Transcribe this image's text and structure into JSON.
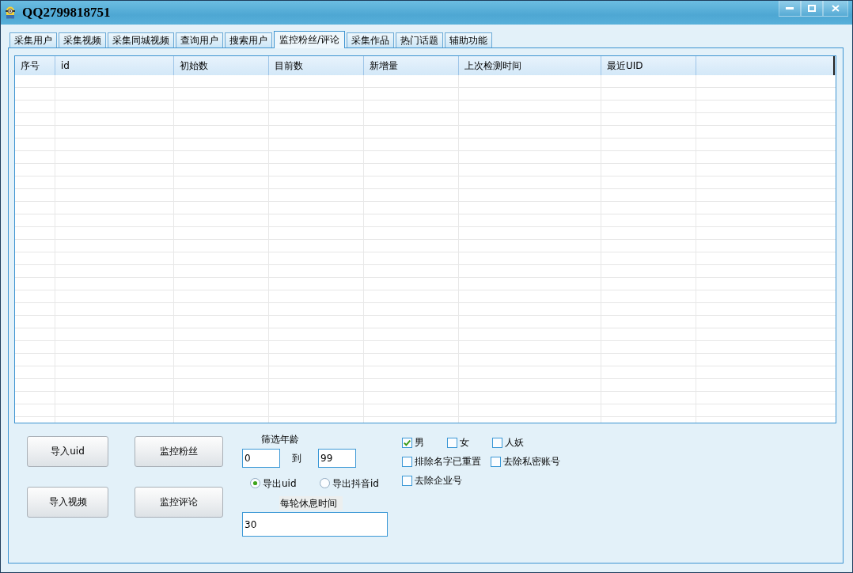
{
  "window": {
    "title": "QQ2799818751"
  },
  "tabs": [
    {
      "label": "采集用户",
      "selected": false
    },
    {
      "label": "采集视频",
      "selected": false
    },
    {
      "label": "采集同城视频",
      "selected": false
    },
    {
      "label": "查询用户",
      "selected": false
    },
    {
      "label": "搜索用户",
      "selected": false
    },
    {
      "label": "监控粉丝/评论",
      "selected": true
    },
    {
      "label": "采集作品",
      "selected": false
    },
    {
      "label": "热门话题",
      "selected": false
    },
    {
      "label": "辅助功能",
      "selected": false
    }
  ],
  "table": {
    "columns": [
      "序号",
      "id",
      "初始数",
      "目前数",
      "新增量",
      "上次检测时间",
      "最近UID"
    ]
  },
  "buttons": [
    "导入uid",
    "监控粉丝",
    "导入视频",
    "监控评论"
  ],
  "age_filter": {
    "label": "筛选年龄",
    "from": "0",
    "separator": "到",
    "to": "99"
  },
  "export_options": [
    {
      "label": "导出uid",
      "selected": true
    },
    {
      "label": "导出抖音id",
      "selected": false
    }
  ],
  "rest_time": {
    "label": "每轮休息时间",
    "value": "30"
  },
  "filter_rows": [
    {
      "options": [
        {
          "label": "男",
          "checked": true
        },
        {
          "label": "女",
          "checked": false
        },
        {
          "label": "人妖",
          "checked": false
        }
      ]
    },
    {
      "options": [
        {
          "label": "排除名字已重置",
          "checked": false
        },
        {
          "label": "去除私密账号",
          "checked": false
        }
      ]
    },
    {
      "options": [
        {
          "label": "去除企业号",
          "checked": false
        }
      ]
    }
  ]
}
